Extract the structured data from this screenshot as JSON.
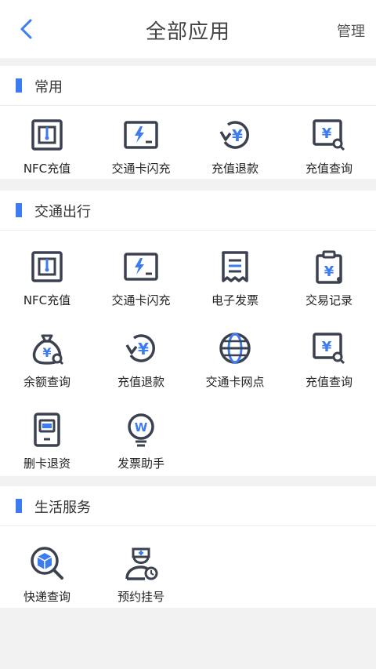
{
  "header": {
    "title": "全部应用",
    "manage_label": "管理"
  },
  "sections": [
    {
      "title": "常用",
      "items": [
        {
          "label": "NFC充值",
          "icon": "nfc-card-icon"
        },
        {
          "label": "交通卡闪充",
          "icon": "flash-charge-icon"
        },
        {
          "label": "充值退款",
          "icon": "refund-icon"
        },
        {
          "label": "充值查询",
          "icon": "recharge-query-icon"
        }
      ]
    },
    {
      "title": "交通出行",
      "items": [
        {
          "label": "NFC充值",
          "icon": "nfc-card-icon"
        },
        {
          "label": "交通卡闪充",
          "icon": "flash-charge-icon"
        },
        {
          "label": "电子发票",
          "icon": "invoice-icon"
        },
        {
          "label": "交易记录",
          "icon": "clipboard-yuan-icon"
        },
        {
          "label": "余额查询",
          "icon": "money-bag-icon"
        },
        {
          "label": "充值退款",
          "icon": "refund-icon"
        },
        {
          "label": "交通卡网点",
          "icon": "globe-icon"
        },
        {
          "label": "充值查询",
          "icon": "recharge-query-icon"
        },
        {
          "label": "删卡退资",
          "icon": "phone-card-icon"
        },
        {
          "label": "发票助手",
          "icon": "lightbulb-icon"
        }
      ]
    },
    {
      "title": "生活服务",
      "items": [
        {
          "label": "快递查询",
          "icon": "parcel-search-icon"
        },
        {
          "label": "预约挂号",
          "icon": "nurse-appointment-icon"
        }
      ]
    }
  ],
  "colors": {
    "accent": "#3d7bf0",
    "icon_stroke": "#3c4150"
  }
}
